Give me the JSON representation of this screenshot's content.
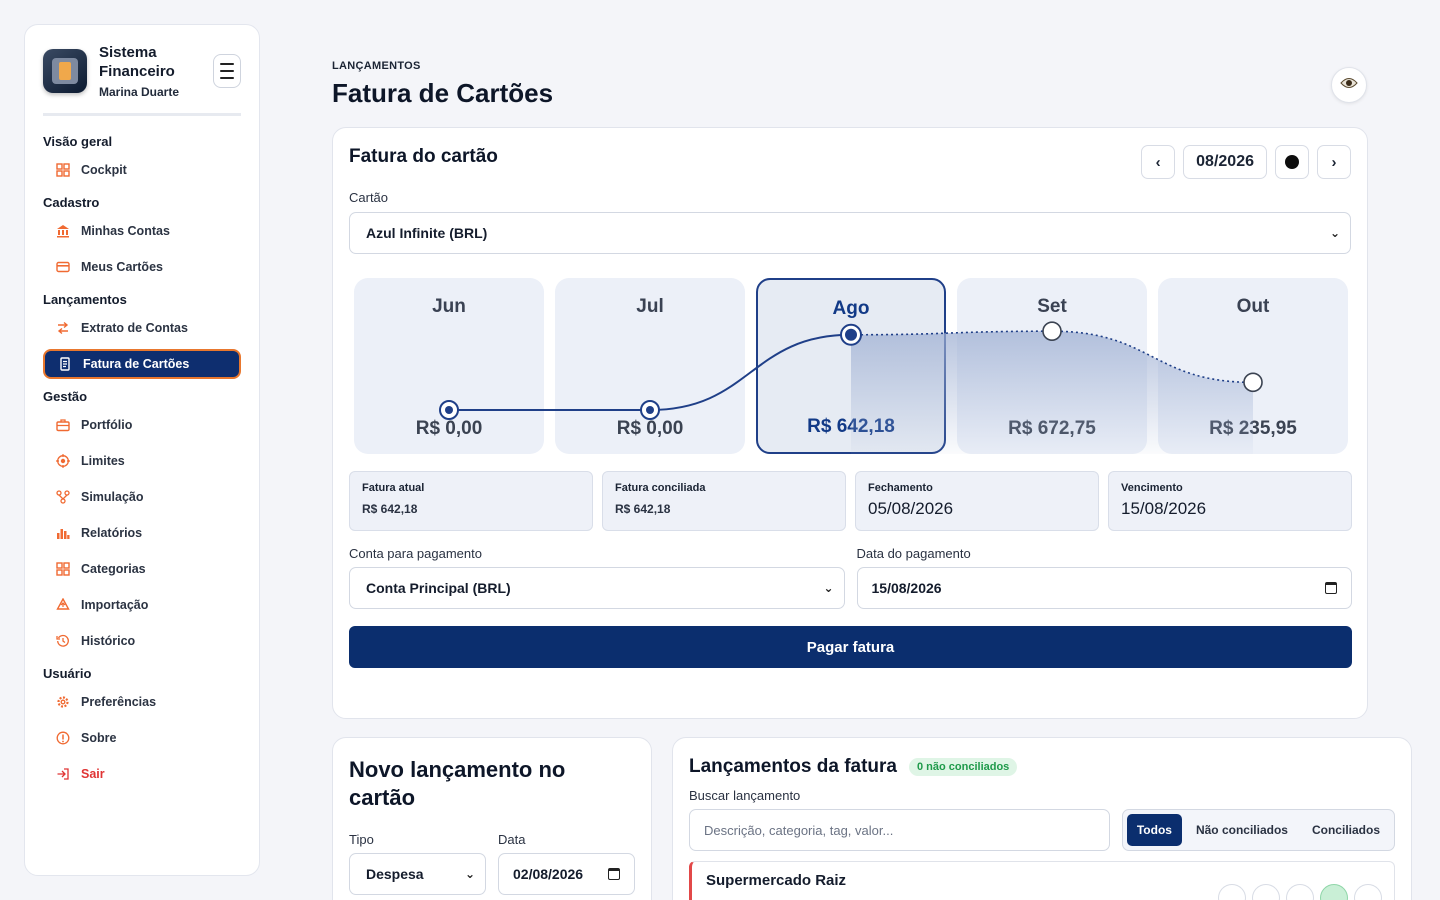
{
  "brand": {
    "title": "Sistema Financeiro",
    "user": "Marina Duarte"
  },
  "nav": {
    "sections": {
      "overview": "Visão geral",
      "cadastro": "Cadastro",
      "lancamentos": "Lançamentos",
      "gestao": "Gestão",
      "usuario": "Usuário"
    },
    "items": {
      "cockpit": "Cockpit",
      "minhas_contas": "Minhas Contas",
      "meus_cartoes": "Meus Cartões",
      "extrato": "Extrato de Contas",
      "fatura": "Fatura de Cartões",
      "portfolio": "Portfólio",
      "limites": "Limites",
      "simulacao": "Simulação",
      "relatorios": "Relatórios",
      "categorias": "Categorias",
      "importacao": "Importação",
      "historico": "Histórico",
      "preferencias": "Preferências",
      "sobre": "Sobre",
      "sair": "Sair"
    },
    "active": "Fatura de Cartões",
    "icons": {
      "cockpit": "grid-icon",
      "minhas_contas": "bank-icon",
      "meus_cartoes": "card-icon",
      "extrato": "transfer-icon",
      "fatura": "invoice-icon",
      "portfolio": "briefcase-icon",
      "limites": "target-icon",
      "simulacao": "flow-icon",
      "relatorios": "bar-chart-icon",
      "categorias": "categories-icon",
      "importacao": "upload-icon",
      "historico": "history-icon",
      "preferencias": "gear-icon",
      "sobre": "info-icon",
      "sair": "logout-icon"
    }
  },
  "header": {
    "eyebrow": "LANÇAMENTOS",
    "title": "Fatura de Cartões"
  },
  "invoice": {
    "title": "Fatura do cartão",
    "month": "08/2026",
    "card_label": "Cartão",
    "card_value": "Azul Infinite (BRL)",
    "stats": [
      {
        "label": "Fatura atual",
        "value": "R$ 642,18"
      },
      {
        "label": "Fatura conciliada",
        "value": "R$ 642,18"
      },
      {
        "label": "Fechamento",
        "value": "05/08/2026"
      },
      {
        "label": "Vencimento",
        "value": "15/08/2026"
      }
    ],
    "pay_account_label": "Conta para pagamento",
    "pay_account_value": "Conta Principal (BRL)",
    "pay_date_label": "Data do pagamento",
    "pay_date_value": "15/08/2026",
    "pay_button": "Pagar fatura"
  },
  "chart_data": {
    "type": "line",
    "categories": [
      "Jun",
      "Jul",
      "Ago",
      "Set",
      "Out"
    ],
    "values": [
      0.0,
      0.0,
      642.18,
      672.75,
      235.95
    ],
    "value_labels": [
      "R$ 0,00",
      "R$ 0,00",
      "R$ 642,18",
      "R$ 672,75",
      "R$ 235,95"
    ],
    "selected": "Ago",
    "ylim": [
      0,
      700
    ],
    "colors": {
      "line": "#1f3f88",
      "fill": "#9fb0d3"
    }
  },
  "new_entry": {
    "title": "Novo lançamento no cartão",
    "type_label": "Tipo",
    "type_value": "Despesa",
    "date_label": "Data",
    "date_value": "02/08/2026"
  },
  "entries": {
    "title": "Lançamentos da fatura",
    "badge": "0 não conciliados",
    "search_label": "Buscar lançamento",
    "search_placeholder": "Descrição, categoria, tag, valor...",
    "filters": [
      "Todos",
      "Não conciliados",
      "Conciliados"
    ],
    "items": [
      {
        "title": "Supermercado Raiz"
      }
    ]
  }
}
